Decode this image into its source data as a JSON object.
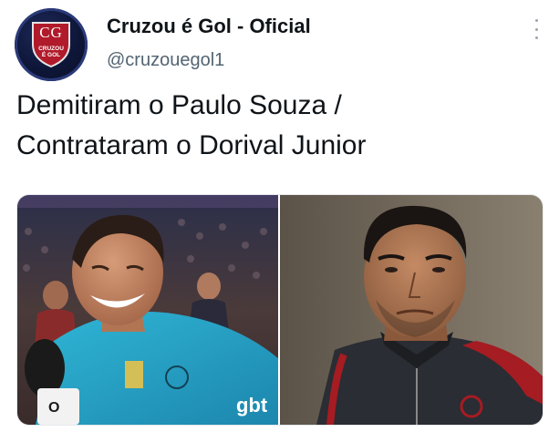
{
  "account": {
    "display_name": "Cruzou é Gol - Oficial",
    "handle": "@cruzouegol1",
    "avatar": {
      "monogram": "CG",
      "brand_line1": "CRUZOU",
      "brand_line2": "É GOL"
    }
  },
  "tweet": {
    "lines": [
      "Demitiram o Paulo Souza /",
      "Contrataram o Dorival Junior"
    ]
  },
  "media": {
    "left_photo": {
      "jersey_text": "gbt",
      "mic_text": "O"
    },
    "right_photo": {}
  },
  "icons": {
    "more": "more-options-icon"
  },
  "colors": {
    "text": "#0f1419",
    "secondary": "#536471",
    "avatar_bg": "#0e1638",
    "shield": "#b01a2a",
    "jersey_left": "#27a6c9",
    "jersey_right": "#2a2d33"
  }
}
